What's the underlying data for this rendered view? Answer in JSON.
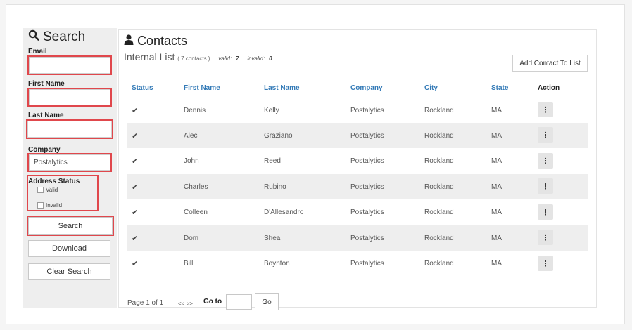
{
  "search": {
    "title": "Search",
    "email_label": "Email",
    "email_value": "",
    "first_name_label": "First Name",
    "first_name_value": "",
    "last_name_label": "Last Name",
    "last_name_value": "",
    "company_label": "Company",
    "company_value": "Postalytics",
    "address_status_label": "Address Status",
    "valid_label": "Valid",
    "invalid_label": "Invalid",
    "search_button": "Search",
    "download_button": "Download",
    "clear_button": "Clear Search"
  },
  "contacts": {
    "title": "Contacts",
    "list_name": "Internal List",
    "count_text": "( 7 contacts )",
    "valid_label": "valid:",
    "valid_count": "7",
    "invalid_label": "invalid:",
    "invalid_count": "0",
    "add_button": "Add Contact To List",
    "columns": [
      "Status",
      "First Name",
      "Last Name",
      "Company",
      "City",
      "State",
      "Action"
    ],
    "rows": [
      {
        "status": "✔",
        "first": "Dennis",
        "last": "Kelly",
        "company": "Postalytics",
        "city": "Rockland",
        "state": "MA"
      },
      {
        "status": "✔",
        "first": "Alec",
        "last": "Graziano",
        "company": "Postalytics",
        "city": "Rockland",
        "state": "MA"
      },
      {
        "status": "✔",
        "first": "John",
        "last": "Reed",
        "company": "Postalytics",
        "city": "Rockland",
        "state": "MA"
      },
      {
        "status": "✔",
        "first": "Charles",
        "last": "Rubino",
        "company": "Postalytics",
        "city": "Rockland",
        "state": "MA"
      },
      {
        "status": "✔",
        "first": "Colleen",
        "last": "D'Allesandro",
        "company": "Postalytics",
        "city": "Rockland",
        "state": "MA"
      },
      {
        "status": "✔",
        "first": "Dom",
        "last": "Shea",
        "company": "Postalytics",
        "city": "Rockland",
        "state": "MA"
      },
      {
        "status": "✔",
        "first": "Bill",
        "last": "Boynton",
        "company": "Postalytics",
        "city": "Rockland",
        "state": "MA"
      }
    ],
    "action_glyph": "⋮",
    "pagination": {
      "page_text": "Page 1 of 1",
      "nav_text": "<< >>",
      "goto_label": "Go to",
      "goto_value": "",
      "go_button": "Go"
    }
  },
  "icons": {
    "search": "search-icon",
    "user": "user-icon",
    "check": "check-icon",
    "more": "more-vertical-icon"
  },
  "colors": {
    "highlight": "#e0474c",
    "link": "#337ab7",
    "row_alt": "#eeeeee"
  }
}
